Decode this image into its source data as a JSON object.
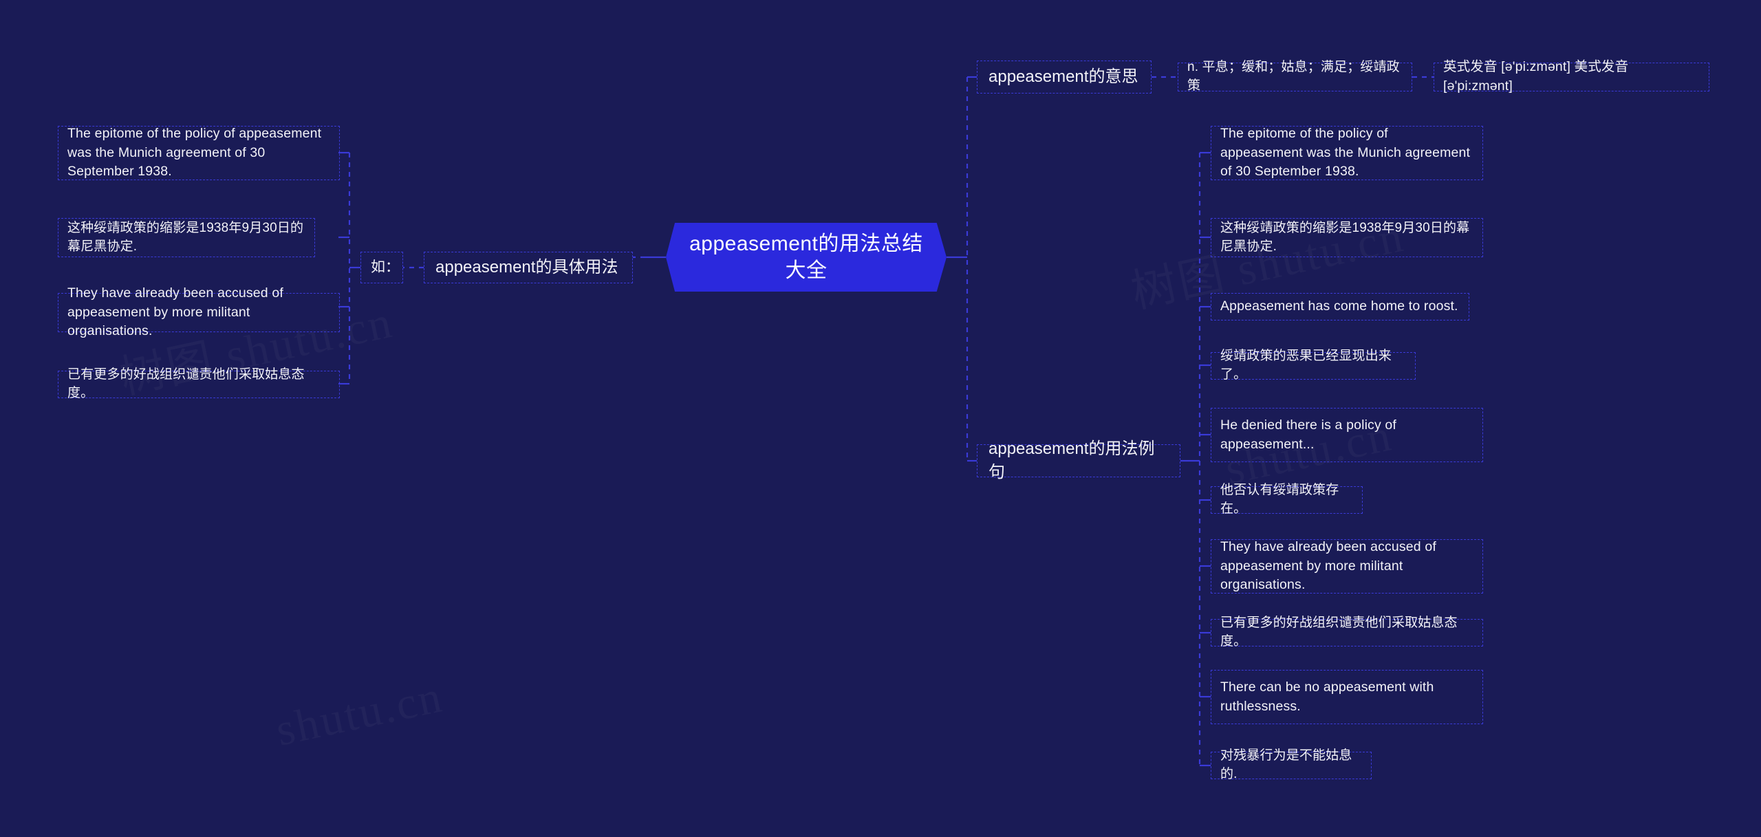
{
  "background_color": "#1a1b56",
  "accent_color": "#2b29dd",
  "border_color": "#3a3ad8",
  "text_color": "#f2f2f7",
  "root": {
    "label": "appeasement的用法总结大全"
  },
  "watermarks": [
    "树图 shutu.cn",
    "树图 shutu.cn",
    "shutu.cn",
    "shutu.cn"
  ],
  "branches": {
    "meaning": {
      "label": "appeasement的意思",
      "definition": "n. 平息；缓和；姑息；满足；绥靖政策",
      "pronunciation": "英式发音 [ə'pi:zmənt] 美式发音 [ə'pi:zmənt]"
    },
    "usage": {
      "label": "appeasement的具体用法",
      "connector_label": "如：",
      "examples": [
        "The epitome of the policy of appeasement was the Munich agreement of 30 September 1938.",
        "这种绥靖政策的缩影是1938年9月30日的幕尼黑协定.",
        "They have already been accused of appeasement by more militant organisations.",
        "已有更多的好战组织谴责他们采取姑息态度。"
      ]
    },
    "sentences": {
      "label": "appeasement的用法例句",
      "examples": [
        "The epitome of the policy of appeasement was the Munich agreement of 30 September 1938.",
        "这种绥靖政策的缩影是1938年9月30日的幕尼黑协定.",
        "Appeasement has come home to roost.",
        "绥靖政策的恶果已经显现出来了。",
        "He denied there is a policy of appeasement...",
        "他否认有绥靖政策存在。",
        "They have already been accused of appeasement by more militant organisations.",
        "已有更多的好战组织谴责他们采取姑息态度。",
        "There can be no appeasement with ruthlessness.",
        "对残暴行为是不能姑息的."
      ]
    }
  }
}
